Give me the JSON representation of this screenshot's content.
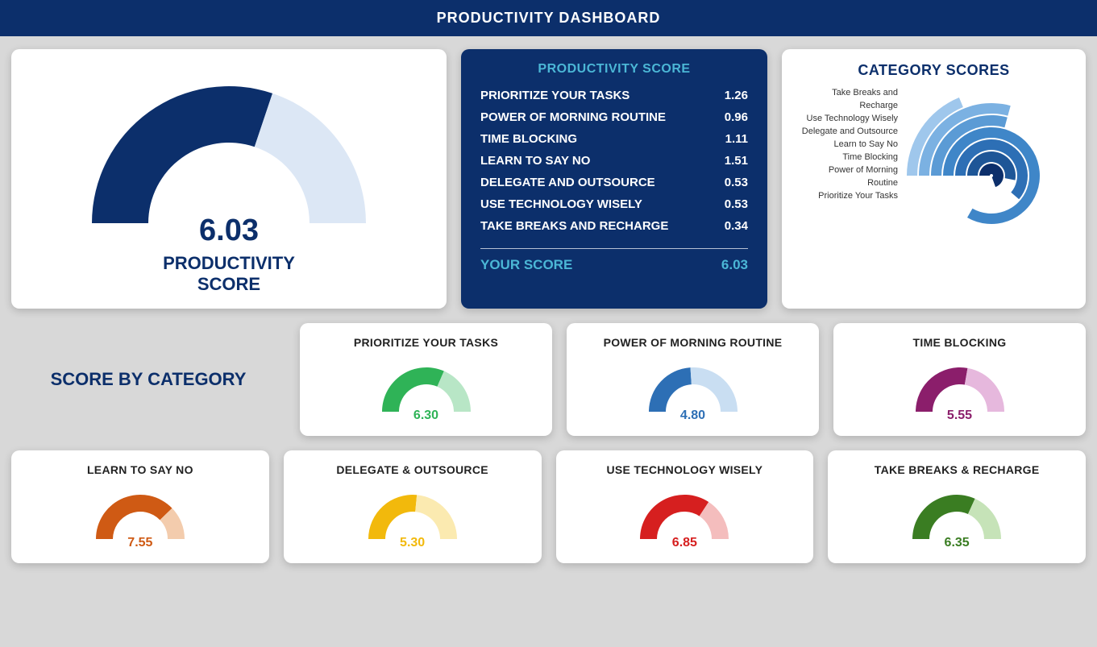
{
  "header": {
    "title": "PRODUCTIVITY DASHBOARD"
  },
  "main_gauge": {
    "value": "6.03",
    "value_num": 6.03,
    "max": 10,
    "label_l1": "PRODUCTIVITY",
    "label_l2": "SCORE"
  },
  "score_panel": {
    "title": "PRODUCTIVITY SCORE",
    "rows": [
      {
        "label": "PRIORITIZE YOUR TASKS",
        "value": "1.26"
      },
      {
        "label": "POWER OF MORNING ROUTINE",
        "value": "0.96"
      },
      {
        "label": "TIME BLOCKING",
        "value": "1.11"
      },
      {
        "label": "LEARN TO SAY NO",
        "value": "1.51"
      },
      {
        "label": "DELEGATE AND OUTSOURCE",
        "value": "0.53"
      },
      {
        "label": "USE TECHNOLOGY WISELY",
        "value": "0.53"
      },
      {
        "label": "TAKE BREAKS AND RECHARGE",
        "value": "0.34"
      }
    ],
    "footer_label": "YOUR SCORE",
    "footer_value": "6.03"
  },
  "category_radial": {
    "title": "CATEGORY SCORES",
    "labels": [
      "Take Breaks and Recharge",
      "Use Technology Wisely",
      "Delegate and Outsource",
      "Learn to Say No",
      "Time Blocking",
      "Power of Morning Routine",
      "Prioritize Your Tasks"
    ]
  },
  "section_title": "SCORE BY CATEGORY",
  "mini": [
    {
      "label": "PRIORITIZE YOUR TASKS",
      "value": "6.30",
      "value_num": 6.3,
      "color": "#2fb357",
      "light": "#b8e6c6"
    },
    {
      "label": "POWER OF MORNING ROUTINE",
      "value": "4.80",
      "value_num": 4.8,
      "color": "#2d6fb5",
      "light": "#c9def2"
    },
    {
      "label": "TIME BLOCKING",
      "value": "5.55",
      "value_num": 5.55,
      "color": "#8b1e6b",
      "light": "#e6b8dd"
    },
    {
      "label": "LEARN TO SAY NO",
      "value": "7.55",
      "value_num": 7.55,
      "color": "#cf5a14",
      "light": "#f3ccad"
    },
    {
      "label": "DELEGATE & OUTSOURCE",
      "value": "5.30",
      "value_num": 5.3,
      "color": "#f2b90c",
      "light": "#fbeab0"
    },
    {
      "label": "USE TECHNOLOGY WISELY",
      "value": "6.85",
      "value_num": 6.85,
      "color": "#d61f1f",
      "light": "#f4bdbd"
    },
    {
      "label": "TAKE BREAKS & RECHARGE",
      "value": "6.35",
      "value_num": 6.35,
      "color": "#3a7d22",
      "light": "#c6e3b8"
    }
  ],
  "chart_data": [
    {
      "type": "gauge",
      "title": "PRODUCTIVITY SCORE",
      "value": 6.03,
      "min": 0,
      "max": 10
    },
    {
      "type": "table",
      "title": "PRODUCTIVITY SCORE breakdown",
      "categories": [
        "Prioritize Your Tasks",
        "Power of Morning Routine",
        "Time Blocking",
        "Learn to Say No",
        "Delegate and Outsource",
        "Use Technology Wisely",
        "Take Breaks and Recharge"
      ],
      "values": [
        1.26,
        0.96,
        1.11,
        1.51,
        0.53,
        0.53,
        0.34
      ],
      "total": 6.03
    },
    {
      "type": "radial-bar",
      "title": "CATEGORY SCORES",
      "categories": [
        "Take Breaks and Recharge",
        "Use Technology Wisely",
        "Delegate and Outsource",
        "Learn to Say No",
        "Time Blocking",
        "Power of Morning Routine",
        "Prioritize Your Tasks"
      ],
      "values": [
        0.34,
        0.53,
        0.53,
        1.51,
        1.11,
        0.96,
        1.26
      ],
      "note": "arc length proportional to contribution; outer ring = first label"
    },
    {
      "type": "gauge-small-multiples",
      "title": "SCORE BY CATEGORY",
      "min": 0,
      "max": 10,
      "series": [
        {
          "name": "Prioritize Your Tasks",
          "value": 6.3
        },
        {
          "name": "Power of Morning Routine",
          "value": 4.8
        },
        {
          "name": "Time Blocking",
          "value": 5.55
        },
        {
          "name": "Learn to Say No",
          "value": 7.55
        },
        {
          "name": "Delegate & Outsource",
          "value": 5.3
        },
        {
          "name": "Use Technology Wisely",
          "value": 6.85
        },
        {
          "name": "Take Breaks & Recharge",
          "value": 6.35
        }
      ]
    }
  ]
}
